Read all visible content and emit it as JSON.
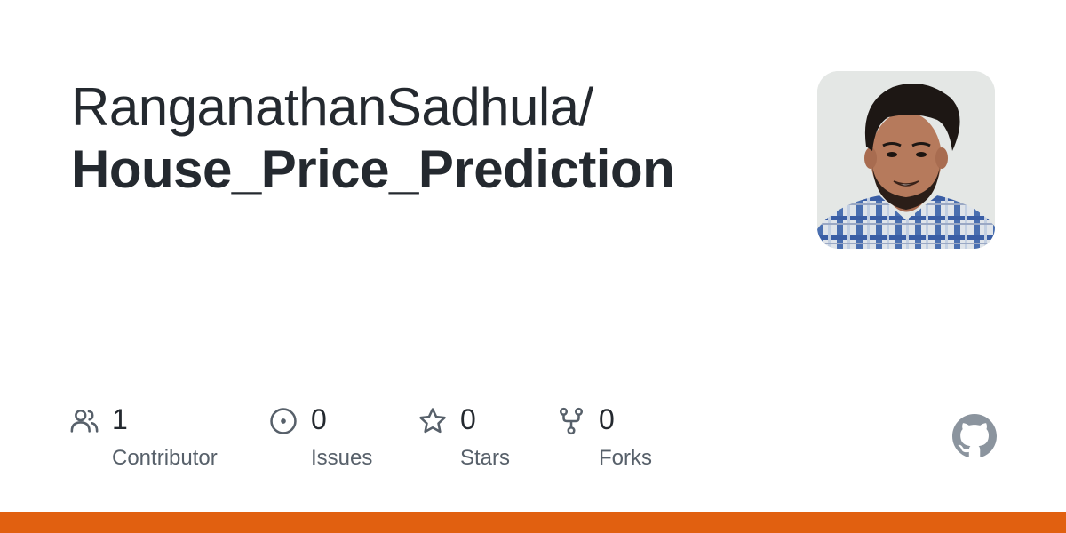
{
  "repo": {
    "owner": "RanganathanSadhula/",
    "name": "House_Price_Prediction"
  },
  "avatar": {
    "icon": "user-avatar-photo"
  },
  "stats": [
    {
      "icon": "people-icon",
      "count": "1",
      "label": "Contributor"
    },
    {
      "icon": "issue-icon",
      "count": "0",
      "label": "Issues"
    },
    {
      "icon": "star-icon",
      "count": "0",
      "label": "Stars"
    },
    {
      "icon": "fork-icon",
      "count": "0",
      "label": "Forks"
    }
  ],
  "logo": {
    "icon": "github-icon"
  },
  "colors": {
    "text": "#24292f",
    "muted": "#57606a",
    "icon": "#57606a",
    "bar": "#e16010"
  }
}
